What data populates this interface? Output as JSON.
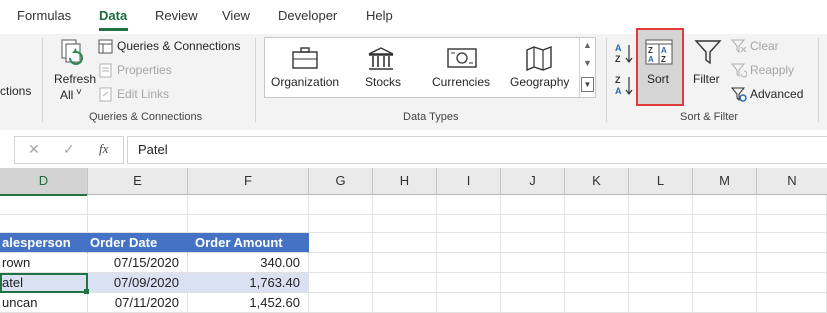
{
  "tabs": [
    "Formulas",
    "Data",
    "Review",
    "View",
    "Developer",
    "Help"
  ],
  "active_tab": "Data",
  "ribbon": {
    "cut_text": "ctions",
    "refresh_label1": "Refresh",
    "refresh_label2": "All",
    "refresh_caret": "˅",
    "queries_connections": "Queries & Connections",
    "properties": "Properties",
    "edit_links": "Edit Links",
    "group_queries": "Queries & Connections",
    "datatypes": [
      "Organization",
      "Stocks",
      "Currencies",
      "Geography"
    ],
    "group_datatypes": "Data Types",
    "sort_label": "Sort",
    "filter_label": "Filter",
    "clear_label": "Clear",
    "reapply_label": "Reapply",
    "advanced_label": "Advanced",
    "group_sortfilter": "Sort & Filter"
  },
  "formula_bar": {
    "cancel": "✕",
    "enter": "✓",
    "fx": "fx",
    "value": "Patel"
  },
  "columns": [
    "D",
    "E",
    "F",
    "G",
    "H",
    "I",
    "J",
    "K",
    "L",
    "M",
    "N"
  ],
  "selected_column": "D",
  "table": {
    "headers": [
      "alesperson",
      "Order Date",
      "Order Amount"
    ],
    "rows": [
      [
        "rown",
        "07/15/2020",
        "340.00"
      ],
      [
        "atel",
        "07/09/2020",
        "1,763.40"
      ],
      [
        "uncan",
        "07/11/2020",
        "1,452.60"
      ]
    ]
  },
  "colors": {
    "accent": "#217346",
    "header_fill": "#4472c4",
    "band_fill": "#d9e1f2",
    "highlight": "#e03a3a"
  }
}
